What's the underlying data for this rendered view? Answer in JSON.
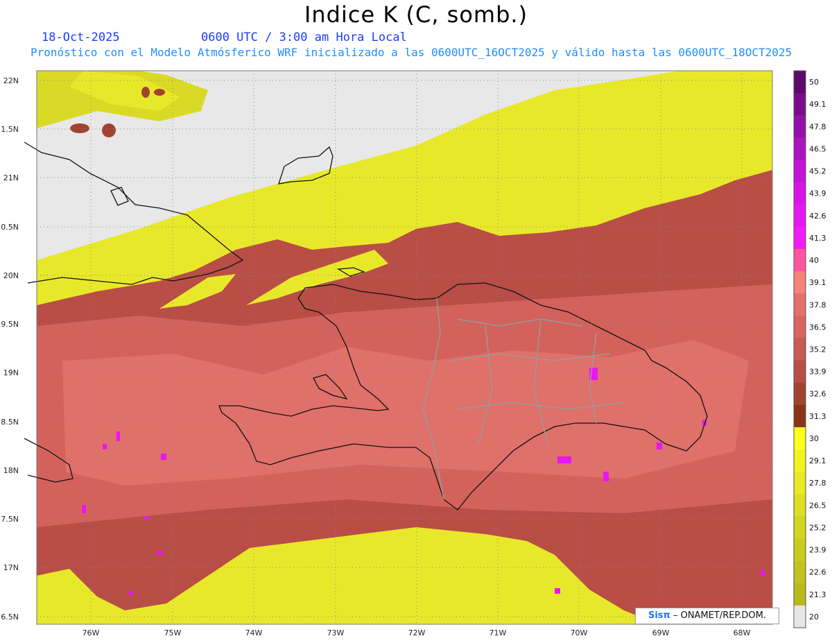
{
  "header": {
    "title": "Indice K (C, somb.)",
    "date": "18-Oct-2025",
    "time": "0600 UTC / 3:00 am Hora Local",
    "subtitle": "Pronóstico con el Modelo Atmósferico WRF inicializado a las 0600UTC_16OCT2025 y válido hasta las  0600UTC_18OCT2025"
  },
  "axes": {
    "lat_labels": [
      "22N",
      "1.5N",
      "21N",
      "0.5N",
      "20N",
      "9.5N",
      "19N",
      "8.5N",
      "18N",
      "7.5N",
      "17N",
      "6.5N"
    ],
    "lon_labels": [
      "76W",
      "75W",
      "74W",
      "73W",
      "72W",
      "71W",
      "70W",
      "69W",
      "68W"
    ]
  },
  "colorbar": {
    "labels": [
      "50",
      "49.1",
      "47.8",
      "46.5",
      "45.2",
      "43.9",
      "42.6",
      "41.3",
      "40",
      "39.1",
      "37.8",
      "36.5",
      "35.2",
      "33.9",
      "32.6",
      "31.3",
      "30",
      "29.1",
      "27.8",
      "26.5",
      "25.2",
      "23.9",
      "22.6",
      "21.3",
      "20"
    ],
    "colors": [
      "#5c0a6e",
      "#7a0c8c",
      "#9310a8",
      "#ad12c2",
      "#c414d6",
      "#d815e6",
      "#e816f2",
      "#f41af9",
      "#ff55a0",
      "#f4837a",
      "#e6706a",
      "#d86560",
      "#c95a54",
      "#b84e46",
      "#a2432f",
      "#8a3416",
      "#ffff1a",
      "#f3f31f",
      "#e9e924",
      "#dede22",
      "#d4d420",
      "#cbcb1e",
      "#c2c21c",
      "#b9b91a",
      "#e6e6e6"
    ]
  },
  "credit": {
    "logo": "Sisπ",
    "text": "– ONAMET/REP.DOM."
  }
}
